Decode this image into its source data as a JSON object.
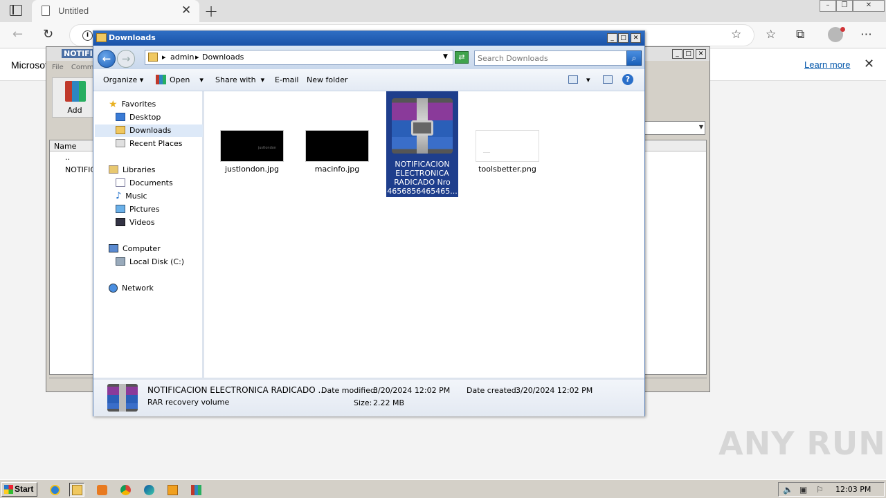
{
  "browser": {
    "tab_title": "Untitled",
    "tab_close": "✕",
    "new_tab": "+",
    "infobar_text": "Microsoft",
    "learn_more": "Learn more",
    "infobar_close": "✕"
  },
  "winrar": {
    "title": "NOTIFIC",
    "menu": "File Comm",
    "add_label": "Add",
    "col_name": "Name",
    "rows": [
      "..",
      "NOTIFIC"
    ]
  },
  "explorer": {
    "title": "Downloads",
    "breadcrumb": [
      "admin",
      "Downloads"
    ],
    "search_placeholder": "Search Downloads",
    "commands": {
      "organize": "Organize",
      "open": "Open",
      "share_with": "Share with",
      "email": "E-mail",
      "new_folder": "New folder"
    },
    "nav": {
      "favorites": "Favorites",
      "desktop": "Desktop",
      "downloads": "Downloads",
      "recent_places": "Recent Places",
      "libraries": "Libraries",
      "documents": "Documents",
      "music": "Music",
      "pictures": "Pictures",
      "videos": "Videos",
      "computer": "Computer",
      "local_disk": "Local Disk (C:)",
      "network": "Network"
    },
    "files": [
      {
        "name": "justlondon.jpg",
        "thumb_text": "justlondon"
      },
      {
        "name": "macinfo.jpg"
      },
      {
        "name": "NOTIFICACION ELECTRONICA RADICADO Nro 4656856465465...",
        "selected": true
      },
      {
        "name": "toolsbetter.png",
        "thumb_text": "____"
      }
    ],
    "details": {
      "name": "NOTIFICACION ELECTRONICA RADICADO ...",
      "type": "RAR recovery volume",
      "date_modified_label": "Date modified:",
      "date_modified": "3/20/2024 12:02 PM",
      "date_created_label": "Date created:",
      "date_created": "3/20/2024 12:02 PM",
      "size_label": "Size:",
      "size": "2.22 MB"
    }
  },
  "taskbar": {
    "start": "Start",
    "clock": "12:03 PM"
  },
  "watermark": "ANY RUN"
}
